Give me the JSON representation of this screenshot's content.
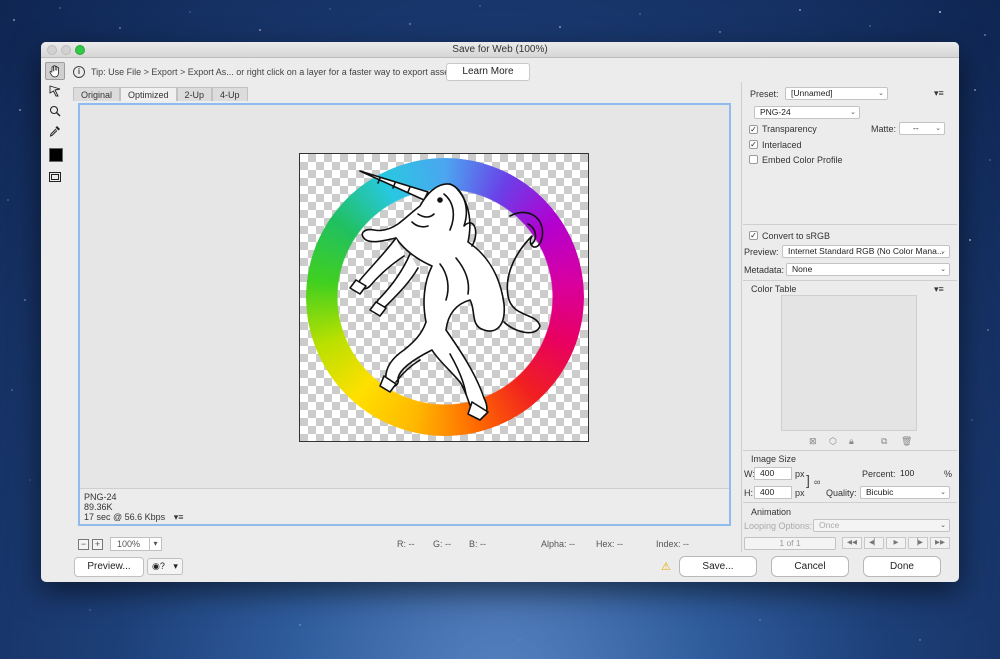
{
  "window": {
    "title": "Save for Web (100%)"
  },
  "tip": {
    "text": "Tip: Use File > Export > Export As...  or right click on a layer for a faster way to export assets",
    "learn_more": "Learn More"
  },
  "tabs": [
    "Original",
    "Optimized",
    "2-Up",
    "4-Up"
  ],
  "tools": [
    "hand-icon",
    "slice-select-icon",
    "zoom-icon",
    "eyedropper-icon",
    "eyedropper-color-swatch",
    "toggle-slices-icon"
  ],
  "canvas": {
    "format": "PNG-24",
    "size": "89.36K",
    "time": "17 sec @ 56.6 Kbps"
  },
  "status": {
    "zoom": "100%",
    "r": "R: --",
    "g": "G: --",
    "b": "B: --",
    "alpha": "Alpha: --",
    "hex": "Hex: --",
    "index": "Index: --"
  },
  "bottom": {
    "preview": "Preview...",
    "save": "Save...",
    "cancel": "Cancel",
    "done": "Done"
  },
  "settings": {
    "preset_label": "Preset:",
    "preset_value": "[Unnamed]",
    "format": "PNG-24",
    "transparency": "Transparency",
    "matte_label": "Matte:",
    "matte_value": "--",
    "interlaced": "Interlaced",
    "embed_color_profile": "Embed Color Profile",
    "convert_srgb": "Convert to sRGB",
    "preview_label": "Preview:",
    "preview_value": "Internet Standard RGB (No Color Mana...",
    "metadata_label": "Metadata:",
    "metadata_value": "None",
    "color_table": "Color Table",
    "image_size": "Image Size",
    "w_label": "W:",
    "w_value": "400",
    "h_label": "H:",
    "h_value": "400",
    "px": "px",
    "percent_label": "Percent:",
    "percent_value": "100",
    "percent_unit": "%",
    "quality_label": "Quality:",
    "quality_value": "Bicubic",
    "animation": "Animation",
    "looping_label": "Looping Options:",
    "looping_value": "Once",
    "frame": "1 of 1"
  },
  "checkbox_state": {
    "transparency": true,
    "interlaced": true,
    "embed_color_profile": false,
    "convert_srgb": true
  }
}
